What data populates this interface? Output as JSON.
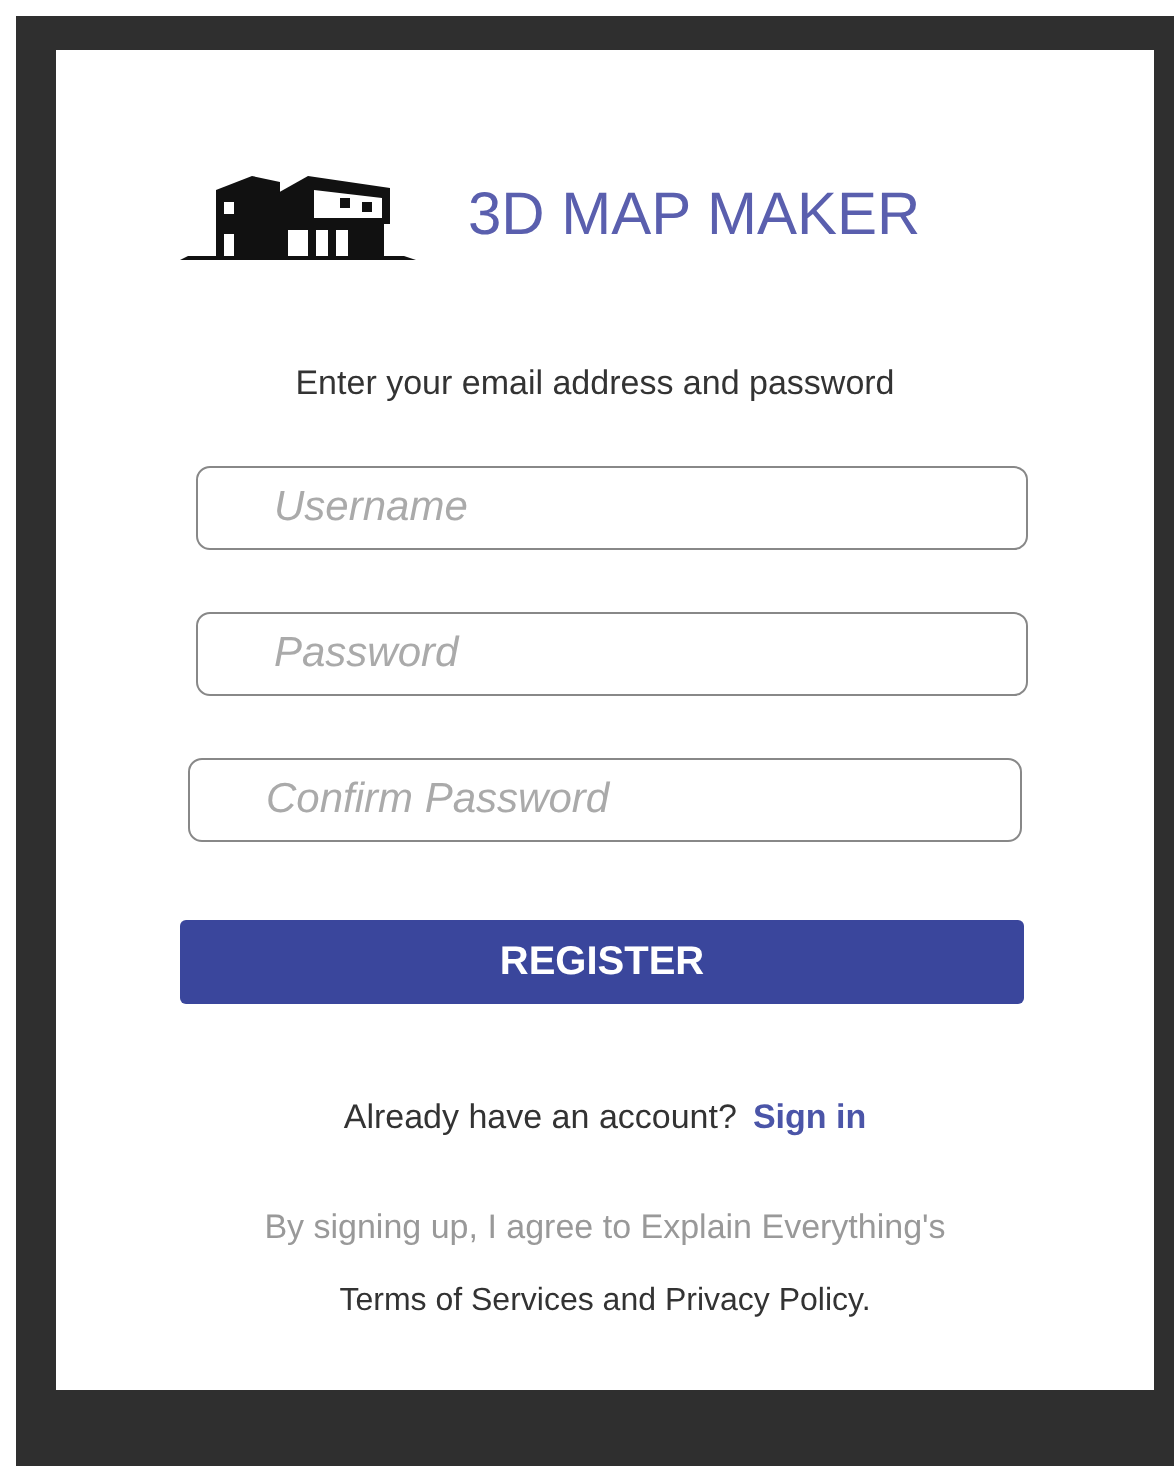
{
  "app": {
    "title": "3D MAP MAKER"
  },
  "instructions": "Enter your email address and password",
  "fields": [
    {
      "placeholder": "Username"
    },
    {
      "placeholder": "Password"
    },
    {
      "placeholder": "Confirm Password"
    }
  ],
  "register_button": "REGISTER",
  "signin_prompt": {
    "text": "Already have an account?",
    "link": "Sign in"
  },
  "terms": {
    "line_1": "By signing up, I agree to Explain Everything's",
    "line_2": "Terms of Services and Privacy Policy."
  }
}
